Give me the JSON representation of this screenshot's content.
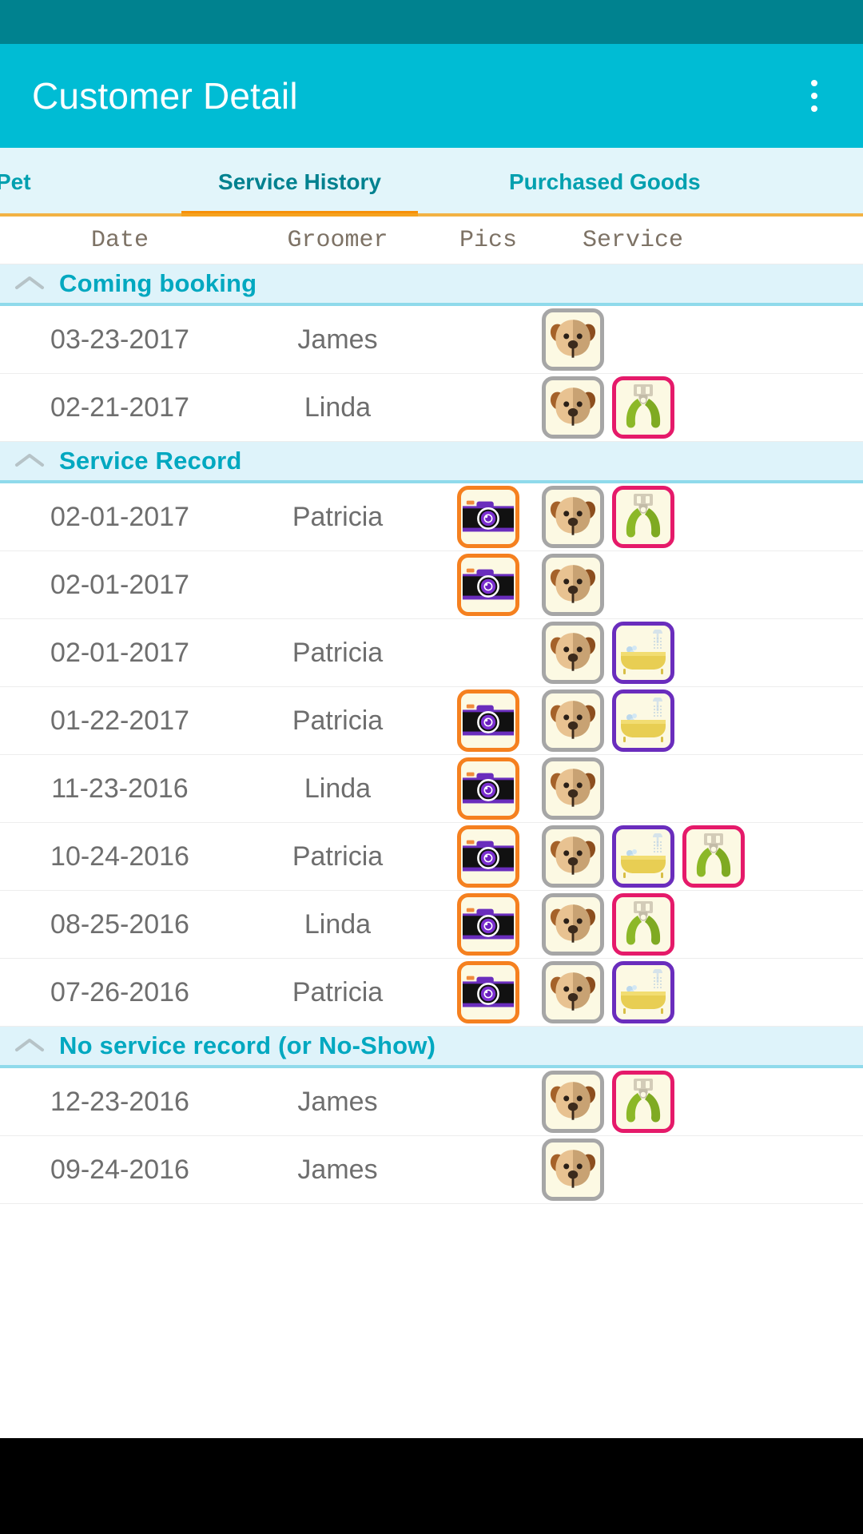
{
  "app": {
    "title": "Customer Detail",
    "overflow_menu": "more-options"
  },
  "theme": {
    "status_bar": "#00828F",
    "app_bar": "#00BCD4",
    "tab_bar_bg": "#E2F5FA",
    "tab_active_color": "#00818F",
    "tab_inactive_color": "#00A0AF",
    "tab_indicator": "#F79009",
    "section_bg": "#DEF3FA",
    "section_text": "#00A8C0",
    "row_text": "#6E6E6E",
    "col_header_text": "#7D7265",
    "icon_border_camera": "#F5801F",
    "icon_border_dog": "#A6A6A6",
    "icon_border_clipper": "#E51A6A",
    "icon_border_bath": "#6A2DBD"
  },
  "tabs": [
    {
      "label": "Pet",
      "active": false
    },
    {
      "label": "Service History",
      "active": true
    },
    {
      "label": "Purchased Goods",
      "active": false
    }
  ],
  "table": {
    "columns": [
      "Date",
      "Groomer",
      "Pics",
      "Service"
    ]
  },
  "sections": [
    {
      "title": "Coming booking",
      "collapse_icon": "chevron-up-icon",
      "rows": [
        {
          "date": "03-23-2017",
          "groomer": "James",
          "pics": [],
          "services": []
        },
        {
          "date": "02-21-2017",
          "groomer": "Linda",
          "pics": [],
          "services": [
            "clipper"
          ]
        }
      ]
    },
    {
      "title": "Service Record",
      "collapse_icon": "chevron-up-icon",
      "rows": [
        {
          "date": "02-01-2017",
          "groomer": "Patricia",
          "pics": [
            "camera"
          ],
          "services": [
            "clipper"
          ]
        },
        {
          "date": "02-01-2017",
          "groomer": "",
          "pics": [
            "camera"
          ],
          "services": []
        },
        {
          "date": "02-01-2017",
          "groomer": "Patricia",
          "pics": [],
          "services": [
            "bath"
          ]
        },
        {
          "date": "01-22-2017",
          "groomer": "Patricia",
          "pics": [
            "camera"
          ],
          "services": [
            "bath"
          ]
        },
        {
          "date": "11-23-2016",
          "groomer": "Linda",
          "pics": [
            "camera"
          ],
          "services": []
        },
        {
          "date": "10-24-2016",
          "groomer": "Patricia",
          "pics": [
            "camera"
          ],
          "services": [
            "bath",
            "clipper"
          ]
        },
        {
          "date": "08-25-2016",
          "groomer": "Linda",
          "pics": [
            "camera"
          ],
          "services": [
            "clipper"
          ]
        },
        {
          "date": "07-26-2016",
          "groomer": "Patricia",
          "pics": [
            "camera"
          ],
          "services": [
            "bath"
          ]
        }
      ]
    },
    {
      "title": "No service record (or No-Show)",
      "collapse_icon": "chevron-up-icon",
      "rows": [
        {
          "date": "12-23-2016",
          "groomer": "James",
          "pics": [],
          "services": [
            "clipper"
          ]
        },
        {
          "date": "09-24-2016",
          "groomer": "James",
          "pics": [],
          "services": []
        }
      ]
    }
  ],
  "icons": {
    "pet_avatar": "dog-face-icon",
    "camera": "camera-icon",
    "clipper": "pet-clipper-icon",
    "bath": "bathtub-shower-icon"
  }
}
